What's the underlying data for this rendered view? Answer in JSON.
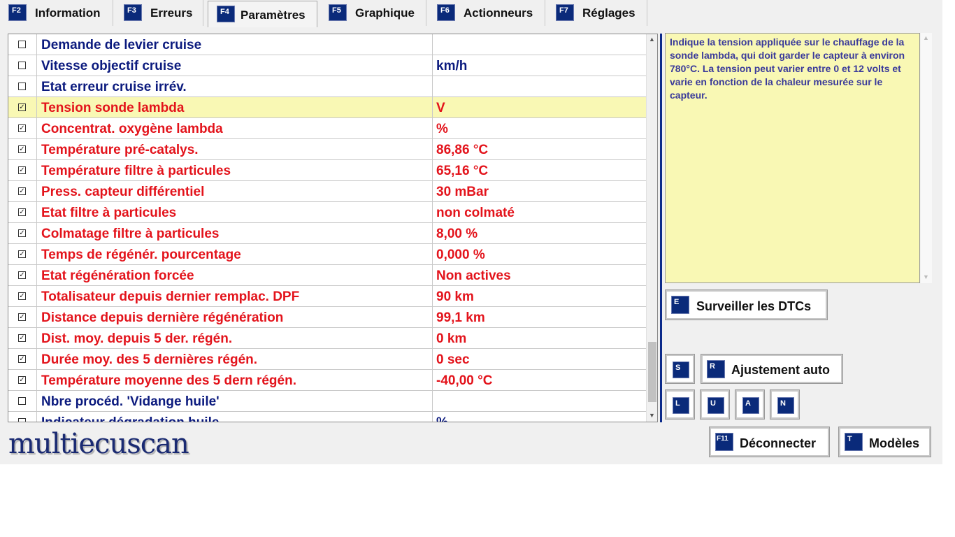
{
  "tabs": [
    {
      "key": "F2",
      "label": "Information",
      "active": false
    },
    {
      "key": "F3",
      "label": "Erreurs",
      "active": false
    },
    {
      "key": "F4",
      "label": "Paramètres",
      "active": true
    },
    {
      "key": "F5",
      "label": "Graphique",
      "active": false
    },
    {
      "key": "F6",
      "label": "Actionneurs",
      "active": false
    },
    {
      "key": "F7",
      "label": "Réglages",
      "active": false
    }
  ],
  "parameters": [
    {
      "name": "Demande de levier cruise",
      "value": "",
      "checked": false,
      "color": "blue"
    },
    {
      "name": "Vitesse objectif cruise",
      "value": " km/h",
      "checked": false,
      "color": "blue"
    },
    {
      "name": "Etat erreur cruise irrév.",
      "value": "",
      "checked": false,
      "color": "blue"
    },
    {
      "name": "Tension sonde lambda",
      "value": " V",
      "checked": true,
      "color": "red",
      "selected": true
    },
    {
      "name": "Concentrat. oxygène lambda",
      "value": " %",
      "checked": true,
      "color": "red"
    },
    {
      "name": "Température pré-catalys.",
      "value": "86,86 °C",
      "checked": true,
      "color": "red"
    },
    {
      "name": "Température filtre à particules",
      "value": "65,16 °C",
      "checked": true,
      "color": "red"
    },
    {
      "name": "Press. capteur différentiel",
      "value": "30 mBar",
      "checked": true,
      "color": "red"
    },
    {
      "name": "Etat filtre à particules",
      "value": "non colmaté",
      "checked": true,
      "color": "red"
    },
    {
      "name": "Colmatage filtre  à particules",
      "value": "8,00 %",
      "checked": true,
      "color": "red"
    },
    {
      "name": "Temps de régénér. pourcentage",
      "value": "0,000 %",
      "checked": true,
      "color": "red"
    },
    {
      "name": "Etat régénération forcée",
      "value": "Non actives",
      "checked": true,
      "color": "red"
    },
    {
      "name": "Totalisateur depuis dernier remplac. DPF",
      "value": "90 km",
      "checked": true,
      "color": "red"
    },
    {
      "name": "Distance depuis dernière régénération",
      "value": "99,1 km",
      "checked": true,
      "color": "red"
    },
    {
      "name": "Dist. moy. depuis 5 der. régén.",
      "value": "0 km",
      "checked": true,
      "color": "red"
    },
    {
      "name": "Durée moy. des 5 dernières régén.",
      "value": "0 sec",
      "checked": true,
      "color": "red"
    },
    {
      "name": "Température moyenne des 5 dern régén.",
      "value": "-40,00 °C",
      "checked": true,
      "color": "red"
    },
    {
      "name": "Nbre procéd. 'Vidange huile'",
      "value": "",
      "checked": false,
      "color": "blue"
    },
    {
      "name": "Indicateur dégradation huile",
      "value": " %",
      "checked": false,
      "color": "blue"
    }
  ],
  "checkmark": "☑",
  "uncheckmark": "☐",
  "help_text": "Indique la tension appliquée sur le chauffage de la sonde lambda, qui doit garder le capteur à environ 780°C. La tension peut varier entre 0 et 12 volts et varie en fonction de la chaleur mesurée sur le capteur.",
  "buttons": {
    "dtc": {
      "key": "E",
      "label": "Surveiller les DTCs"
    },
    "s": {
      "key": "S"
    },
    "auto": {
      "key": "R",
      "label": "Ajustement auto"
    },
    "l": {
      "key": "L"
    },
    "u": {
      "key": "U"
    },
    "a": {
      "key": "A"
    },
    "n": {
      "key": "N"
    },
    "disconnect": {
      "key": "F11",
      "label": "Déconnecter"
    },
    "models": {
      "key": "T",
      "label": "Modèles"
    }
  },
  "logo": "multiecuscan",
  "colors": {
    "red": "#e3131b",
    "blue": "#0b1a7e",
    "highlight": "#f9f8b4",
    "key_bg": "#0a2a7a"
  }
}
